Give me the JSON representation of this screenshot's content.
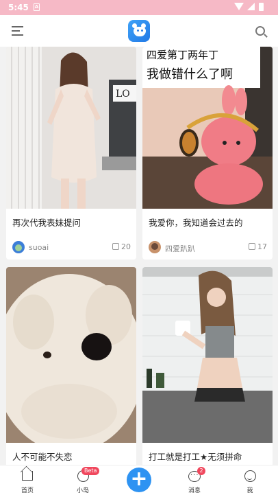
{
  "status_bar": {
    "time": "5:45",
    "sim_label": "A"
  },
  "colors": {
    "accent": "#2e93f2",
    "status_bar": "#f6b9c6",
    "badge": "#f0475d"
  },
  "header": {
    "menu_icon": "menu-icon",
    "logo_icon": "app-logo-icon",
    "search_icon": "search-icon"
  },
  "posts": [
    {
      "title": "再次代我表妹提问",
      "author": "suoai",
      "likes": "20",
      "image_overlay_text": []
    },
    {
      "title": "我爱你，我知道会过去的",
      "author": "四爱趴趴",
      "likes": "17",
      "image_overlay_text": [
        "四爱第丁两年丁",
        "我做错什么了啊"
      ]
    },
    {
      "title": "人不可能不失恋"
    },
    {
      "title": "打工就是打工★无须拼命"
    }
  ],
  "tabbar": {
    "home": "首页",
    "island": "小岛",
    "island_badge": "Beta",
    "add": "+",
    "messages": "消息",
    "messages_badge": "2",
    "me": "我"
  }
}
